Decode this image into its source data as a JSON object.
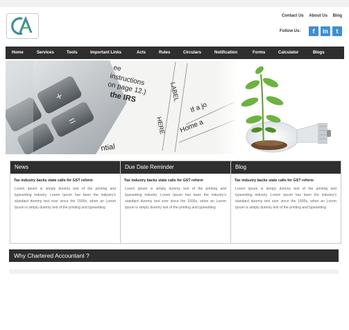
{
  "header": {
    "logo_text": "CA",
    "top_links": [
      "Contact Us",
      "About Us",
      "Blog"
    ],
    "follow_label": "Follow Us:",
    "social": [
      {
        "name": "facebook",
        "glyph": "f"
      },
      {
        "name": "linkedin",
        "glyph": "in"
      },
      {
        "name": "twitter",
        "glyph": "t"
      }
    ]
  },
  "nav": {
    "items": [
      "Home",
      "Services",
      "Tools",
      "Important Links",
      "Acts",
      "Rules",
      "Circulars",
      "Notification",
      "Forms",
      "Calculator",
      "Blogs"
    ]
  },
  "banner": {
    "paper_lines": [
      "ee",
      "instructions",
      "on page 12.)",
      "the IRS",
      "LABEL",
      "HERE",
      "If a jo",
      "Home a",
      "ntial"
    ]
  },
  "boxes": [
    {
      "heading": "News",
      "title": "Tax industry backs state calls for GST reform",
      "text": "Lorem Ipsum is simply dummy text of the printing and typesetting industry. Lorem Ipsum has been the industry's standard dummy text ever since the 1500s, when an Lorem Ipsum is simply dummy text of the printing and typesetting"
    },
    {
      "heading": "Due Date Reminder",
      "title": "Tax industry backs state calls for GST reform",
      "text": "Lorem Ipsum is simply dummy text of the printing and typesetting industry. Lorem Ipsum has been the industry's standard dummy text ever since the 1500s, when an Lorem Ipsum is simply dummy text of the printing and typesetting"
    },
    {
      "heading": "Blog",
      "title": "Tax industry backs state calls for GST reform",
      "text": "Lorem Ipsum is simply dummy text of the printing and typesetting industry. Lorem Ipsum has been the industry's standard dummy text ever since the 1500s, when an Lorem Ipsum is simply dummy text of the printing and typesetting"
    }
  ],
  "why": {
    "heading": "Why Chartered Accountant ?"
  },
  "colors": {
    "nav_bg": "#2e2e2e",
    "social_blue": "#3d8fd1",
    "logo_teal": "#3a8f95",
    "logo_green": "#6cb33e"
  }
}
